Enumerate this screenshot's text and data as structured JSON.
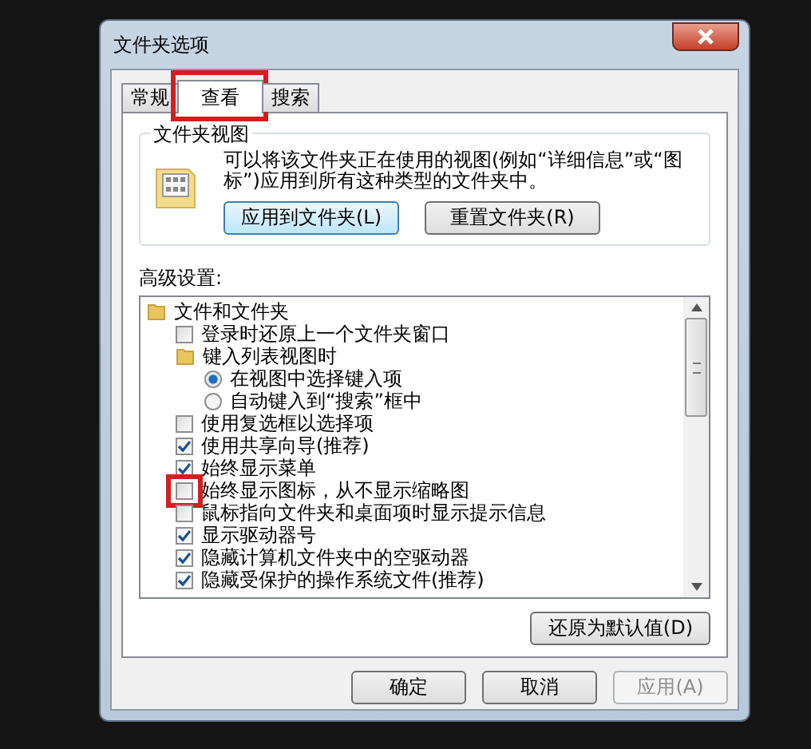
{
  "window": {
    "title": "文件夹选项"
  },
  "tabs": [
    {
      "label": "常规",
      "selected": false,
      "highlighted": false
    },
    {
      "label": "查看",
      "selected": true,
      "highlighted": true
    },
    {
      "label": "搜索",
      "selected": false,
      "highlighted": false
    }
  ],
  "folder_views": {
    "title": "文件夹视图",
    "description": "可以将该文件夹正在使用的视图(例如“详细信息”或“图标”)应用到所有这种类型的文件夹中。",
    "buttons": [
      "应用到文件夹(L)",
      "重置文件夹(R)"
    ]
  },
  "advanced": {
    "label": "高级设置:",
    "items": [
      {
        "kind": "folder",
        "label": "文件和文件夹",
        "children": [
          {
            "kind": "check",
            "label": "登录时还原上一个文件夹窗口",
            "checked": false,
            "highlighted": false
          },
          {
            "kind": "folder",
            "label": "键入列表视图时",
            "children": [
              {
                "kind": "radio",
                "label": "在视图中选择键入项",
                "selected": true
              },
              {
                "kind": "radio",
                "label": "自动键入到“搜索”框中",
                "selected": false
              }
            ]
          },
          {
            "kind": "check",
            "label": "使用复选框以选择项",
            "checked": false,
            "highlighted": false
          },
          {
            "kind": "check",
            "label": "使用共享向导(推荐)",
            "checked": true,
            "highlighted": false
          },
          {
            "kind": "check",
            "label": "始终显示菜单",
            "checked": true,
            "highlighted": false
          },
          {
            "kind": "check",
            "label": "始终显示图标，从不显示缩略图",
            "checked": false,
            "highlighted": true
          },
          {
            "kind": "check",
            "label": "鼠标指向文件夹和桌面项时显示提示信息",
            "checked": false,
            "highlighted": false
          },
          {
            "kind": "check",
            "label": "显示驱动器号",
            "checked": true,
            "highlighted": false
          },
          {
            "kind": "check",
            "label": "隐藏计算机文件夹中的空驱动器",
            "checked": true,
            "highlighted": false
          },
          {
            "kind": "check",
            "label": "隐藏受保护的操作系统文件(推荐)",
            "checked": true,
            "highlighted": false
          }
        ]
      }
    ],
    "restore_button": "还原为默认值(D)"
  },
  "buttons": [
    {
      "label": "确定",
      "disabled": false
    },
    {
      "label": "取消",
      "disabled": false
    },
    {
      "label": "应用(A)",
      "disabled": true
    }
  ]
}
